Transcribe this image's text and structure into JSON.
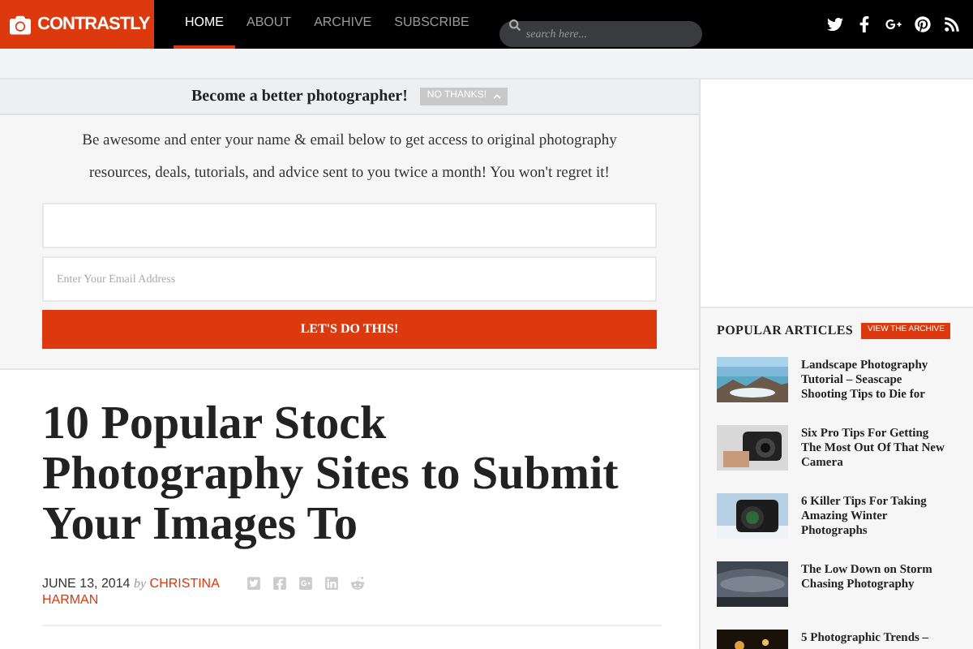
{
  "header": {
    "logo": "CONTRASTLY",
    "nav": [
      {
        "label": "HOME",
        "selected": true
      },
      {
        "label": "ABOUT",
        "selected": false
      },
      {
        "label": "ARCHIVE",
        "selected": false
      },
      {
        "label": "SUBSCRIBE",
        "selected": false
      }
    ],
    "search": {
      "placeholder": "search here..."
    }
  },
  "optin": {
    "title": "Become a better photographer!",
    "dismiss": "NO THANKS!",
    "text": "Be awesome and enter your name & email below to get access to original photography resources, deals, tutorials, and advice sent to you twice a month! You won't regret it!",
    "email_placeholder": "Enter Your Email Address",
    "button": "LET'S DO THIS!"
  },
  "article": {
    "title": "10 Popular Stock Photography Sites to Submit Your Images To",
    "date": "JUNE 13, 2014",
    "by": "by",
    "author": "CHRISTINA HARMAN"
  },
  "sidebar": {
    "heading": "POPULAR ARTICLES",
    "badge": "VIEW THE ARCHIVE",
    "articles": [
      {
        "title": "Landscape Photography Tutorial – Seascape Shooting Tips to Die for"
      },
      {
        "title": "Six Pro Tips For Getting The Most Out Of That New Camera"
      },
      {
        "title": "6 Killer Tips For Taking Amazing Winter Photographs"
      },
      {
        "title": "The Low Down on Storm Chasing Photography"
      },
      {
        "title": "5 Photographic Trends –"
      }
    ]
  }
}
